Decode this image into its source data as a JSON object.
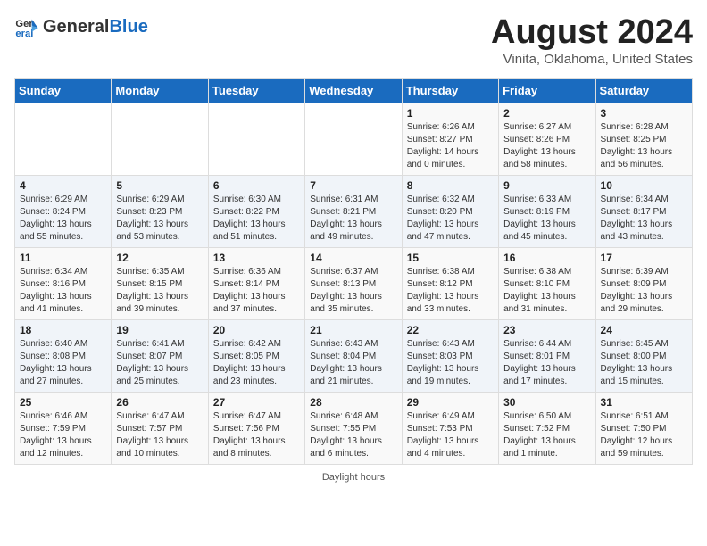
{
  "header": {
    "logo_general": "General",
    "logo_blue": "Blue",
    "main_title": "August 2024",
    "subtitle": "Vinita, Oklahoma, United States"
  },
  "footer": {
    "note": "Daylight hours"
  },
  "calendar": {
    "days_of_week": [
      "Sunday",
      "Monday",
      "Tuesday",
      "Wednesday",
      "Thursday",
      "Friday",
      "Saturday"
    ],
    "weeks": [
      [
        {
          "day": "",
          "info": ""
        },
        {
          "day": "",
          "info": ""
        },
        {
          "day": "",
          "info": ""
        },
        {
          "day": "",
          "info": ""
        },
        {
          "day": "1",
          "info": "Sunrise: 6:26 AM\nSunset: 8:27 PM\nDaylight: 14 hours\nand 0 minutes."
        },
        {
          "day": "2",
          "info": "Sunrise: 6:27 AM\nSunset: 8:26 PM\nDaylight: 13 hours\nand 58 minutes."
        },
        {
          "day": "3",
          "info": "Sunrise: 6:28 AM\nSunset: 8:25 PM\nDaylight: 13 hours\nand 56 minutes."
        }
      ],
      [
        {
          "day": "4",
          "info": "Sunrise: 6:29 AM\nSunset: 8:24 PM\nDaylight: 13 hours\nand 55 minutes."
        },
        {
          "day": "5",
          "info": "Sunrise: 6:29 AM\nSunset: 8:23 PM\nDaylight: 13 hours\nand 53 minutes."
        },
        {
          "day": "6",
          "info": "Sunrise: 6:30 AM\nSunset: 8:22 PM\nDaylight: 13 hours\nand 51 minutes."
        },
        {
          "day": "7",
          "info": "Sunrise: 6:31 AM\nSunset: 8:21 PM\nDaylight: 13 hours\nand 49 minutes."
        },
        {
          "day": "8",
          "info": "Sunrise: 6:32 AM\nSunset: 8:20 PM\nDaylight: 13 hours\nand 47 minutes."
        },
        {
          "day": "9",
          "info": "Sunrise: 6:33 AM\nSunset: 8:19 PM\nDaylight: 13 hours\nand 45 minutes."
        },
        {
          "day": "10",
          "info": "Sunrise: 6:34 AM\nSunset: 8:17 PM\nDaylight: 13 hours\nand 43 minutes."
        }
      ],
      [
        {
          "day": "11",
          "info": "Sunrise: 6:34 AM\nSunset: 8:16 PM\nDaylight: 13 hours\nand 41 minutes."
        },
        {
          "day": "12",
          "info": "Sunrise: 6:35 AM\nSunset: 8:15 PM\nDaylight: 13 hours\nand 39 minutes."
        },
        {
          "day": "13",
          "info": "Sunrise: 6:36 AM\nSunset: 8:14 PM\nDaylight: 13 hours\nand 37 minutes."
        },
        {
          "day": "14",
          "info": "Sunrise: 6:37 AM\nSunset: 8:13 PM\nDaylight: 13 hours\nand 35 minutes."
        },
        {
          "day": "15",
          "info": "Sunrise: 6:38 AM\nSunset: 8:12 PM\nDaylight: 13 hours\nand 33 minutes."
        },
        {
          "day": "16",
          "info": "Sunrise: 6:38 AM\nSunset: 8:10 PM\nDaylight: 13 hours\nand 31 minutes."
        },
        {
          "day": "17",
          "info": "Sunrise: 6:39 AM\nSunset: 8:09 PM\nDaylight: 13 hours\nand 29 minutes."
        }
      ],
      [
        {
          "day": "18",
          "info": "Sunrise: 6:40 AM\nSunset: 8:08 PM\nDaylight: 13 hours\nand 27 minutes."
        },
        {
          "day": "19",
          "info": "Sunrise: 6:41 AM\nSunset: 8:07 PM\nDaylight: 13 hours\nand 25 minutes."
        },
        {
          "day": "20",
          "info": "Sunrise: 6:42 AM\nSunset: 8:05 PM\nDaylight: 13 hours\nand 23 minutes."
        },
        {
          "day": "21",
          "info": "Sunrise: 6:43 AM\nSunset: 8:04 PM\nDaylight: 13 hours\nand 21 minutes."
        },
        {
          "day": "22",
          "info": "Sunrise: 6:43 AM\nSunset: 8:03 PM\nDaylight: 13 hours\nand 19 minutes."
        },
        {
          "day": "23",
          "info": "Sunrise: 6:44 AM\nSunset: 8:01 PM\nDaylight: 13 hours\nand 17 minutes."
        },
        {
          "day": "24",
          "info": "Sunrise: 6:45 AM\nSunset: 8:00 PM\nDaylight: 13 hours\nand 15 minutes."
        }
      ],
      [
        {
          "day": "25",
          "info": "Sunrise: 6:46 AM\nSunset: 7:59 PM\nDaylight: 13 hours\nand 12 minutes."
        },
        {
          "day": "26",
          "info": "Sunrise: 6:47 AM\nSunset: 7:57 PM\nDaylight: 13 hours\nand 10 minutes."
        },
        {
          "day": "27",
          "info": "Sunrise: 6:47 AM\nSunset: 7:56 PM\nDaylight: 13 hours\nand 8 minutes."
        },
        {
          "day": "28",
          "info": "Sunrise: 6:48 AM\nSunset: 7:55 PM\nDaylight: 13 hours\nand 6 minutes."
        },
        {
          "day": "29",
          "info": "Sunrise: 6:49 AM\nSunset: 7:53 PM\nDaylight: 13 hours\nand 4 minutes."
        },
        {
          "day": "30",
          "info": "Sunrise: 6:50 AM\nSunset: 7:52 PM\nDaylight: 13 hours\nand 1 minute."
        },
        {
          "day": "31",
          "info": "Sunrise: 6:51 AM\nSunset: 7:50 PM\nDaylight: 12 hours\nand 59 minutes."
        }
      ]
    ]
  }
}
